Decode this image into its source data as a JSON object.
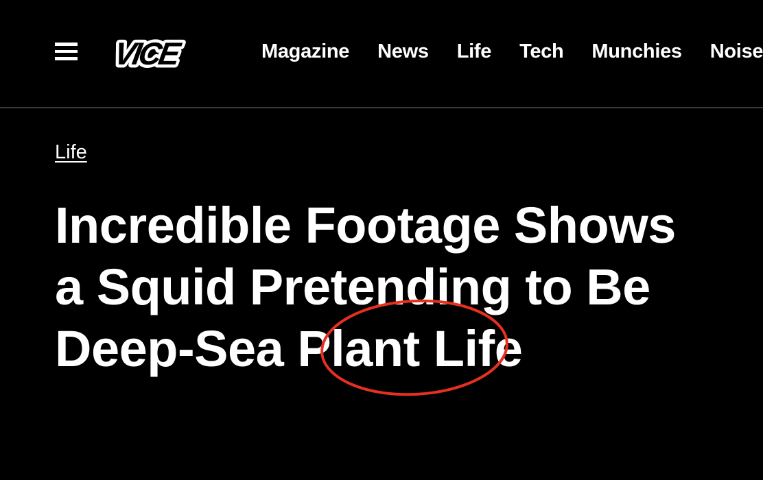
{
  "header": {
    "menu_icon": "hamburger-menu-icon",
    "logo_text": "VICE",
    "nav_items": [
      {
        "label": "Magazine"
      },
      {
        "label": "News"
      },
      {
        "label": "Life"
      },
      {
        "label": "Tech"
      },
      {
        "label": "Munchies"
      },
      {
        "label": "Noisey"
      }
    ]
  },
  "article": {
    "section": "Life",
    "title_lines": [
      "Incredible Footage Shows",
      "a Squid Pretending to Be",
      "Deep-Sea Plant Life"
    ]
  },
  "annotation": {
    "shape": "ellipse",
    "color": "#e8301f"
  }
}
